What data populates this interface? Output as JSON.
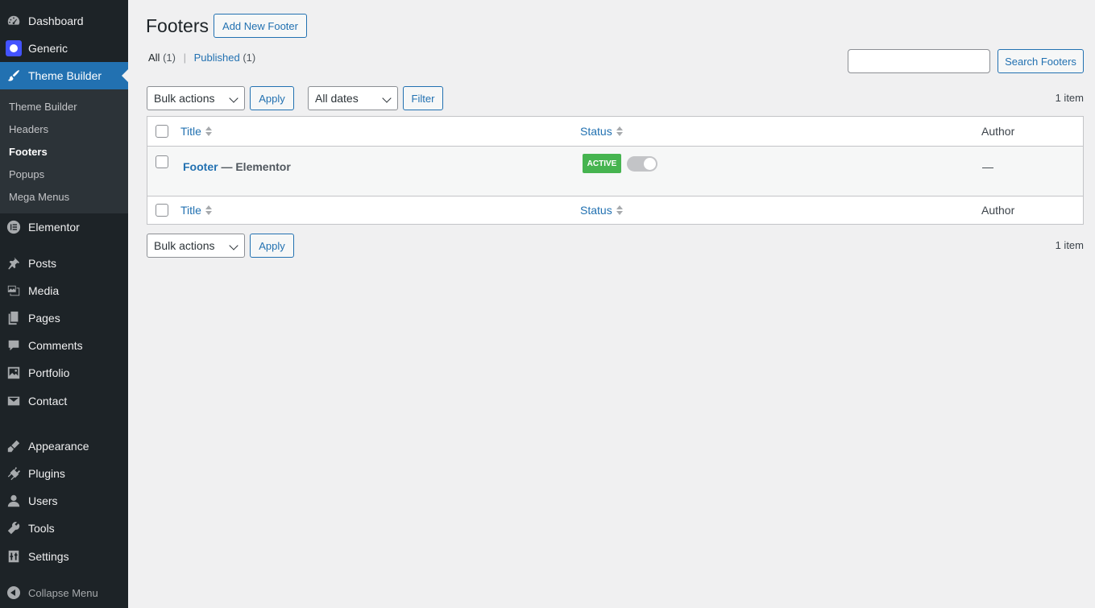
{
  "sidebar": {
    "items": [
      {
        "label": "Dashboard",
        "icon": "dashboard-icon"
      },
      {
        "label": "Generic",
        "icon": "generic-logo-icon"
      },
      {
        "label": "Theme Builder",
        "icon": "brush-icon"
      },
      {
        "label": "Elementor",
        "icon": "elementor-icon"
      },
      {
        "label": "Posts",
        "icon": "pin-icon"
      },
      {
        "label": "Media",
        "icon": "media-icon"
      },
      {
        "label": "Pages",
        "icon": "pages-icon"
      },
      {
        "label": "Comments",
        "icon": "comment-icon"
      },
      {
        "label": "Portfolio",
        "icon": "portfolio-icon"
      },
      {
        "label": "Contact",
        "icon": "envelope-icon"
      },
      {
        "label": "Appearance",
        "icon": "appearance-icon"
      },
      {
        "label": "Plugins",
        "icon": "plugin-icon"
      },
      {
        "label": "Users",
        "icon": "user-icon"
      },
      {
        "label": "Tools",
        "icon": "wrench-icon"
      },
      {
        "label": "Settings",
        "icon": "settings-icon"
      }
    ],
    "submenu": [
      "Theme Builder",
      "Headers",
      "Footers",
      "Popups",
      "Mega Menus"
    ],
    "current_submenu": "Footers",
    "collapse_label": "Collapse Menu"
  },
  "header": {
    "title": "Footers",
    "add_new_label": "Add New Footer"
  },
  "views": {
    "all_label": "All",
    "all_count": "(1)",
    "separator": "|",
    "published_label": "Published",
    "published_count": "(1)"
  },
  "search": {
    "value": "",
    "button_label": "Search Footers"
  },
  "tablenav": {
    "bulk_actions": "Bulk actions",
    "apply_label": "Apply",
    "dates_filter": "All dates",
    "filter_label": "Filter",
    "items_count": "1 item"
  },
  "table": {
    "columns": [
      "Title",
      "Status",
      "Author"
    ],
    "rows": [
      {
        "title": "Footer",
        "title_suffix": "— Elementor",
        "status_badge": "ACTIVE",
        "status_toggle": true,
        "author": "—"
      }
    ]
  },
  "colors": {
    "sidebar_bg": "#1d2327",
    "accent": "#2271b1",
    "active_badge": "#46b450"
  }
}
